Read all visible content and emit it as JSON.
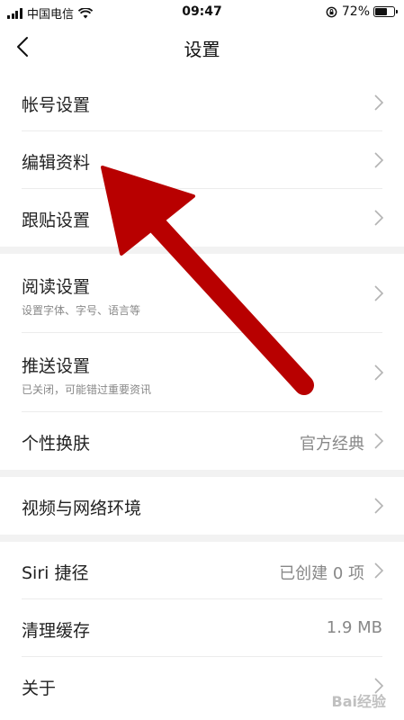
{
  "status_bar": {
    "carrier": "中国电信",
    "time": "09:47",
    "battery_percent": "72%",
    "battery_level": 0.72
  },
  "nav": {
    "title": "设置"
  },
  "sections": [
    {
      "rows": [
        {
          "label": "帐号设置"
        },
        {
          "label": "编辑资料"
        },
        {
          "label": "跟贴设置"
        }
      ]
    },
    {
      "rows": [
        {
          "label": "阅读设置",
          "subtitle": "设置字体、字号、语言等"
        },
        {
          "label": "推送设置",
          "subtitle": "已关闭，可能错过重要资讯"
        },
        {
          "label": "个性换肤",
          "value": "官方经典"
        }
      ]
    },
    {
      "rows": [
        {
          "label": "视频与网络环境"
        }
      ]
    },
    {
      "rows": [
        {
          "label": "Siri 捷径",
          "value": "已创建 0 项"
        },
        {
          "label": "清理缓存",
          "value": "1.9 MB"
        },
        {
          "label": "关于"
        }
      ]
    }
  ],
  "watermark": "Bai经验",
  "colors": {
    "arrow": "#b80000",
    "section_gap": "#f2f2f2",
    "divider": "#ececec",
    "secondary_text": "#888888"
  }
}
